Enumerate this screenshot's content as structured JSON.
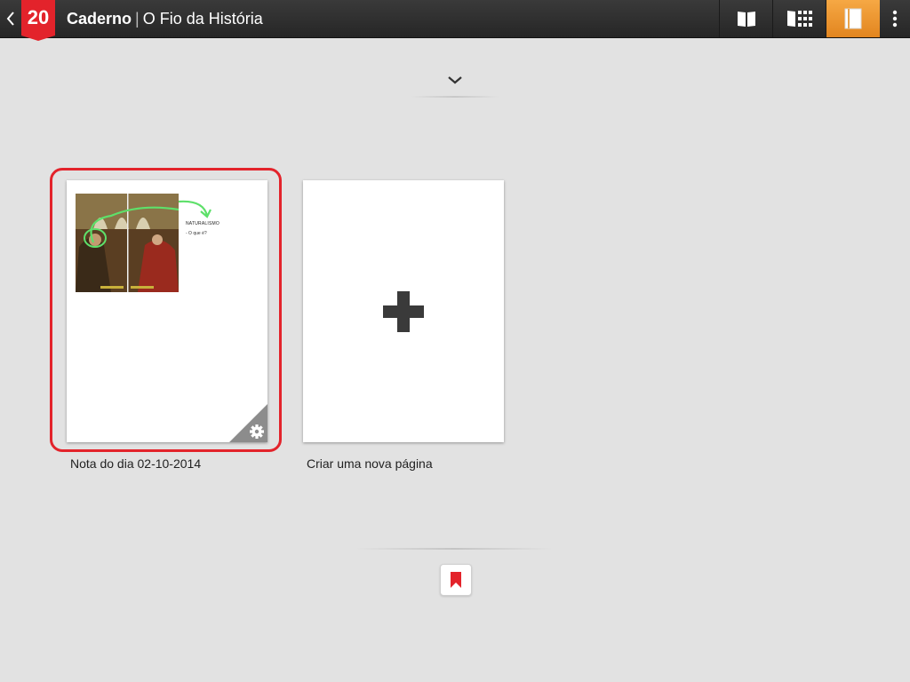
{
  "header": {
    "logo_text": "20",
    "title_bold": "Caderno",
    "title_separator": "|",
    "title_rest": "O Fio da História"
  },
  "toolbar": {
    "buttons": [
      {
        "icon": "book-icon",
        "active": false
      },
      {
        "icon": "grid-book-icon",
        "active": false
      },
      {
        "icon": "notebook-icon",
        "active": true
      }
    ],
    "menu_icon": "more-vert-icon"
  },
  "pages": [
    {
      "caption": "Nota do dia 02-10-2014",
      "selected": true,
      "note_heading": "NATURALISMO",
      "note_sub": "- O que é?"
    },
    {
      "caption": "Criar uma nova página",
      "selected": false
    }
  ],
  "colors": {
    "accent_orange": "#e8901f",
    "brand_red": "#e3232b",
    "background": "#e2e2e2"
  }
}
